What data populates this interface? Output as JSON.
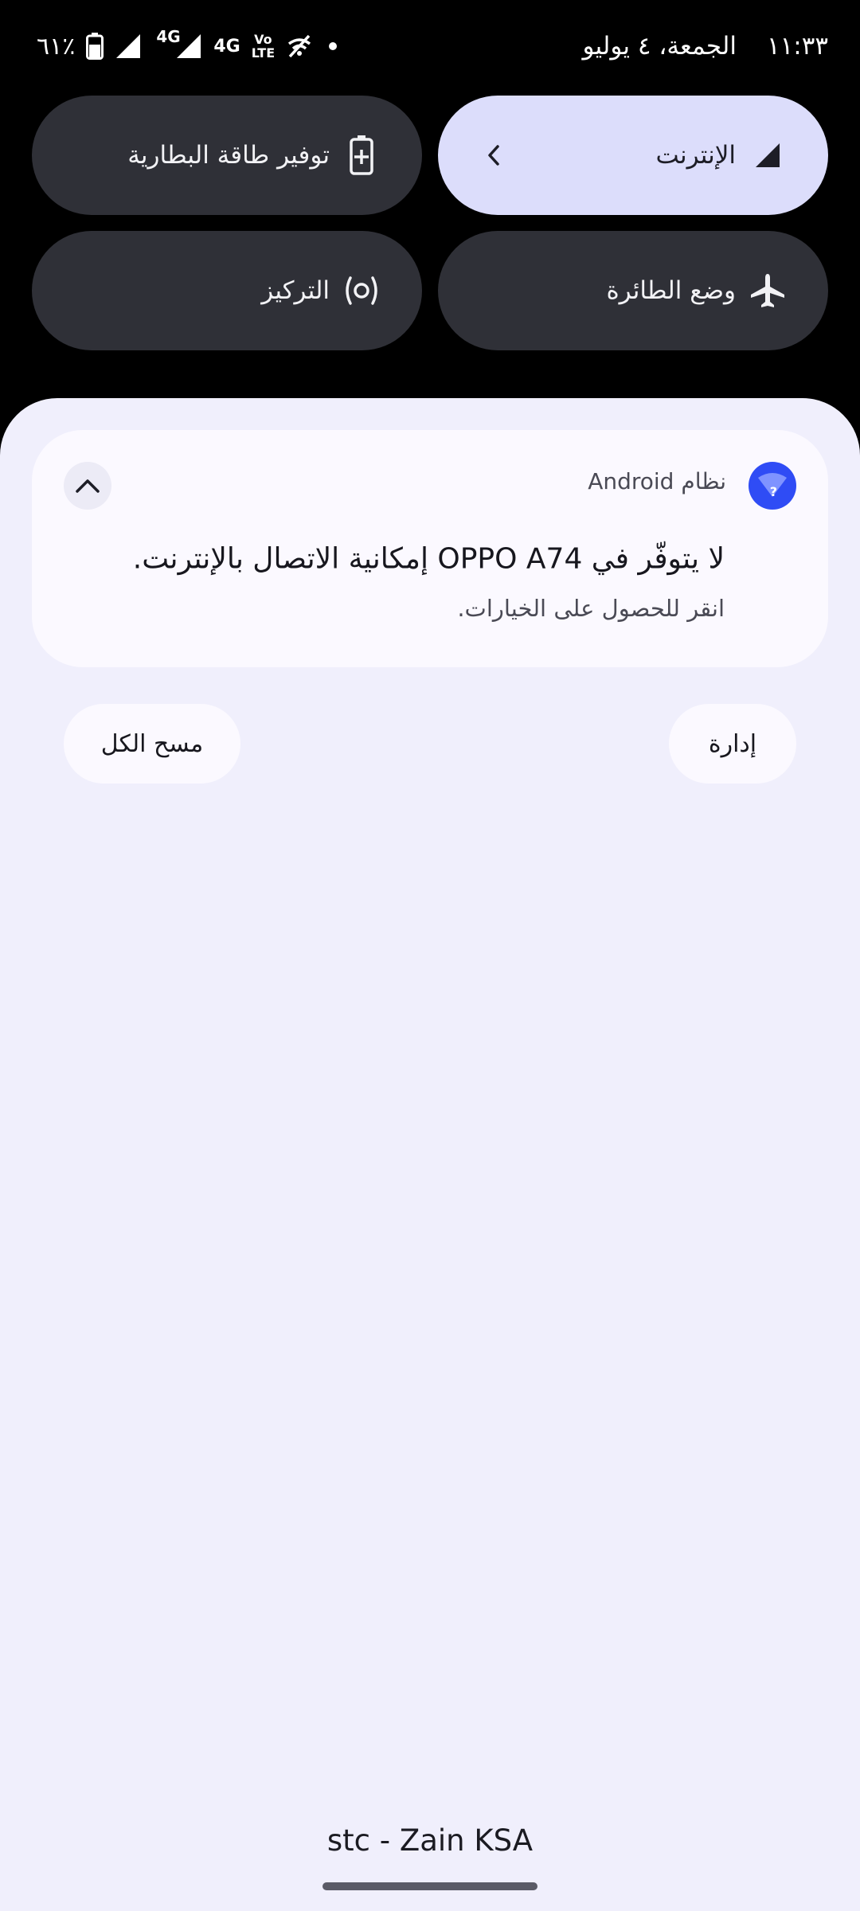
{
  "status_bar": {
    "time": "١١:٣٣",
    "date": "الجمعة، ٤ يوليو",
    "battery_percent": "٦١٪",
    "network_1": "4G",
    "network_2": "4G",
    "volte_top": "Vo",
    "volte_bottom": "LTE"
  },
  "quick_tiles": {
    "internet": {
      "label": "الإنترنت",
      "icon": "signal-icon",
      "active": true
    },
    "battery_saver": {
      "label": "توفير طاقة البطارية",
      "icon": "battery-plus-icon"
    },
    "airplane": {
      "label": "وضع الطائرة",
      "icon": "airplane-icon"
    },
    "focus": {
      "label": "التركيز",
      "icon": "focus-icon"
    }
  },
  "notification": {
    "app_name": "نظام Android",
    "app_icon": "wifi-question-icon",
    "title": "لا يتوفّر في OPPO A74 إمكانية الاتصال بالإنترنت.",
    "body": "انقر للحصول على الخيارات."
  },
  "actions": {
    "manage_label": "إدارة",
    "clear_all_label": "مسح الكل"
  },
  "carrier": "stc - Zain KSA",
  "colors": {
    "accent": "#2f4cf5",
    "active_tile": "#dcddfb",
    "tile": "#2f3037",
    "shade": "#f0effc"
  }
}
